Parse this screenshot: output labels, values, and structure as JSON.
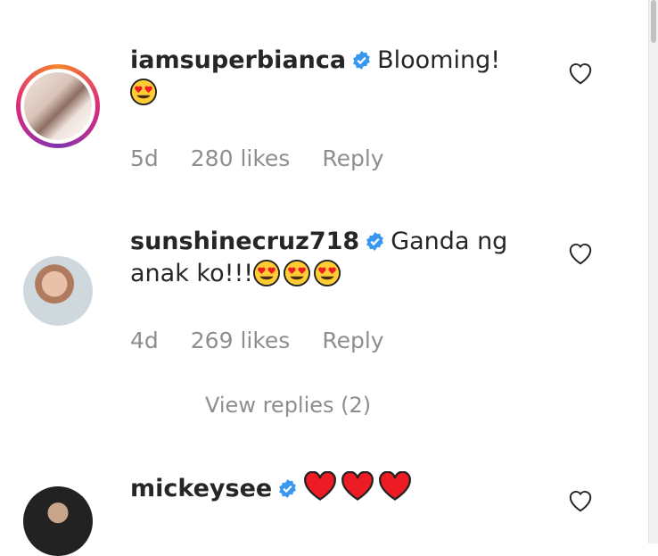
{
  "comments": [
    {
      "username": "iamsuperbianca",
      "verified": true,
      "text": "Blooming!",
      "age": "5d",
      "likes": "280 likes",
      "reply_label": "Reply"
    },
    {
      "username": "sunshinecruz718",
      "verified": true,
      "text_line1": "Ganda ng",
      "text_line2": "anak ko!!!",
      "age": "4d",
      "likes": "269 likes",
      "reply_label": "Reply",
      "view_replies": "View replies (2)"
    },
    {
      "username": "mickeysee",
      "verified": true
    }
  ],
  "icons": {
    "verified": "verified-badge-icon",
    "like": "heart-outline-icon",
    "emoji_heart_eyes": "heart-eyes-emoji",
    "emoji_red_heart": "red-heart-emoji"
  },
  "colors": {
    "verified_blue": "#3897f0",
    "meta_gray": "#8e8e8e",
    "heart_red": "#ed1c24"
  }
}
